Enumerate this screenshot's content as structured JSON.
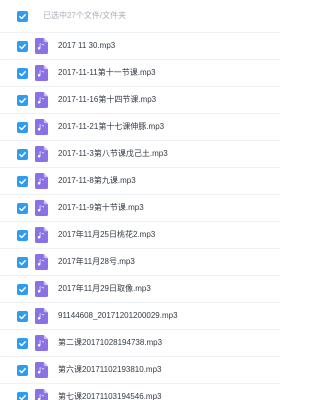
{
  "selection_summary": "已选中27个文件/文件夹",
  "accent_color": "#2e9cf0",
  "file_icon_color": "#8a72e6",
  "icons": {
    "checkbox": "check-icon",
    "file": "audio-file-icon"
  },
  "files": [
    {
      "name": "2017 11 30.mp3",
      "checked": true
    },
    {
      "name": "2017-11-11第十一节课.mp3",
      "checked": true
    },
    {
      "name": "2017-11-16第十四节课.mp3",
      "checked": true
    },
    {
      "name": "2017-11-21第十七课伸豚.mp3",
      "checked": true
    },
    {
      "name": "2017-11-3第八节课戊己土.mp3",
      "checked": true
    },
    {
      "name": "2017-11-8第九课.mp3",
      "checked": true
    },
    {
      "name": "2017-11-9第十节课.mp3",
      "checked": true
    },
    {
      "name": "2017年11月25日桃花2.mp3",
      "checked": true
    },
    {
      "name": "2017年11月28号.mp3",
      "checked": true
    },
    {
      "name": "2017年11月29日取像.mp3",
      "checked": true
    },
    {
      "name": "91144608_20171201200029.mp3",
      "checked": true
    },
    {
      "name": "第二课20171028194738.mp3",
      "checked": true
    },
    {
      "name": "第六课20171102193810.mp3",
      "checked": true
    },
    {
      "name": "第七课20171103194546.mp3",
      "checked": true
    }
  ]
}
